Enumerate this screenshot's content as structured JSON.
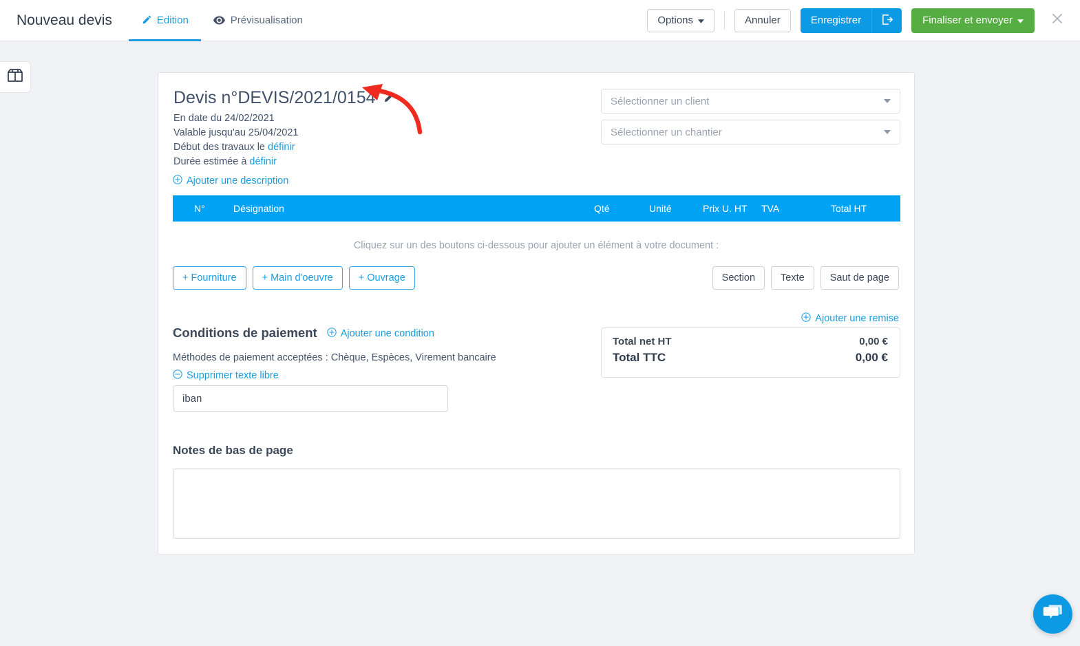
{
  "header": {
    "app_title": "Nouveau devis",
    "tabs": [
      {
        "label": "Edition",
        "icon": "pencil-icon",
        "active": true
      },
      {
        "label": "Prévisualisation",
        "icon": "eye-icon",
        "active": false
      }
    ],
    "actions": {
      "options_label": "Options",
      "cancel_label": "Annuler",
      "save_label": "Enregistrer",
      "save_exit_icon": "save-and-exit-icon",
      "finalize_label": "Finaliser et envoyer",
      "close_icon": "close-icon"
    }
  },
  "left_rail": {
    "icon": "open-box-icon"
  },
  "document": {
    "title": "Devis n°DEVIS/2021/0154",
    "edit_title_icon": "pencil-icon",
    "meta": {
      "date_line": "En date du 24/02/2021",
      "valid_line": "Valable jusqu'au 25/04/2021",
      "start_prefix": "Début des travaux le ",
      "start_link": "définir",
      "duration_prefix": "Durée estimée à ",
      "duration_link": "définir"
    },
    "add_description_label": "Ajouter une description",
    "selects": {
      "client_placeholder": "Sélectionner un client",
      "chantier_placeholder": "Sélectionner un chantier"
    },
    "table": {
      "columns": [
        "N°",
        "Désignation",
        "Qté",
        "Unité",
        "Prix U. HT",
        "TVA",
        "Total HT"
      ],
      "rows": [],
      "empty_hint": "Cliquez sur un des boutons ci-dessous pour ajouter un élément à votre document :"
    },
    "add_item_buttons": [
      {
        "label": "+ Fourniture"
      },
      {
        "label": "+ Main d'oeuvre"
      },
      {
        "label": "+ Ouvrage"
      }
    ],
    "add_block_buttons": [
      {
        "label": "Section"
      },
      {
        "label": "Texte"
      },
      {
        "label": "Saut de page"
      }
    ],
    "add_discount_label": "Ajouter une remise",
    "payment": {
      "title": "Conditions de paiement",
      "add_condition_label": "Ajouter une condition",
      "methods_text": "Méthodes de paiement acceptées : Chèque, Espèces, Virement bancaire",
      "delete_free_text_label": "Supprimer texte libre",
      "iban_value": "iban",
      "iban_placeholder": ""
    },
    "totals": {
      "net_ht_label": "Total net HT",
      "net_ht_value": "0,00 €",
      "ttc_label": "Total TTC",
      "ttc_value": "0,00 €"
    },
    "footer_notes": {
      "title": "Notes de bas de page",
      "value": "",
      "placeholder": ""
    }
  },
  "chat": {
    "icon": "chat-bubble-icon"
  },
  "annotation": {
    "type": "red-curved-arrow",
    "points_to": "edit-title-icon",
    "color": "#ef2b1f"
  },
  "colors": {
    "accent_blue": "#0d9ae5",
    "table_header_blue": "#00a2f3",
    "green": "#56ae43",
    "page_bg": "#f0f2f5",
    "link": "#1a9de0"
  }
}
